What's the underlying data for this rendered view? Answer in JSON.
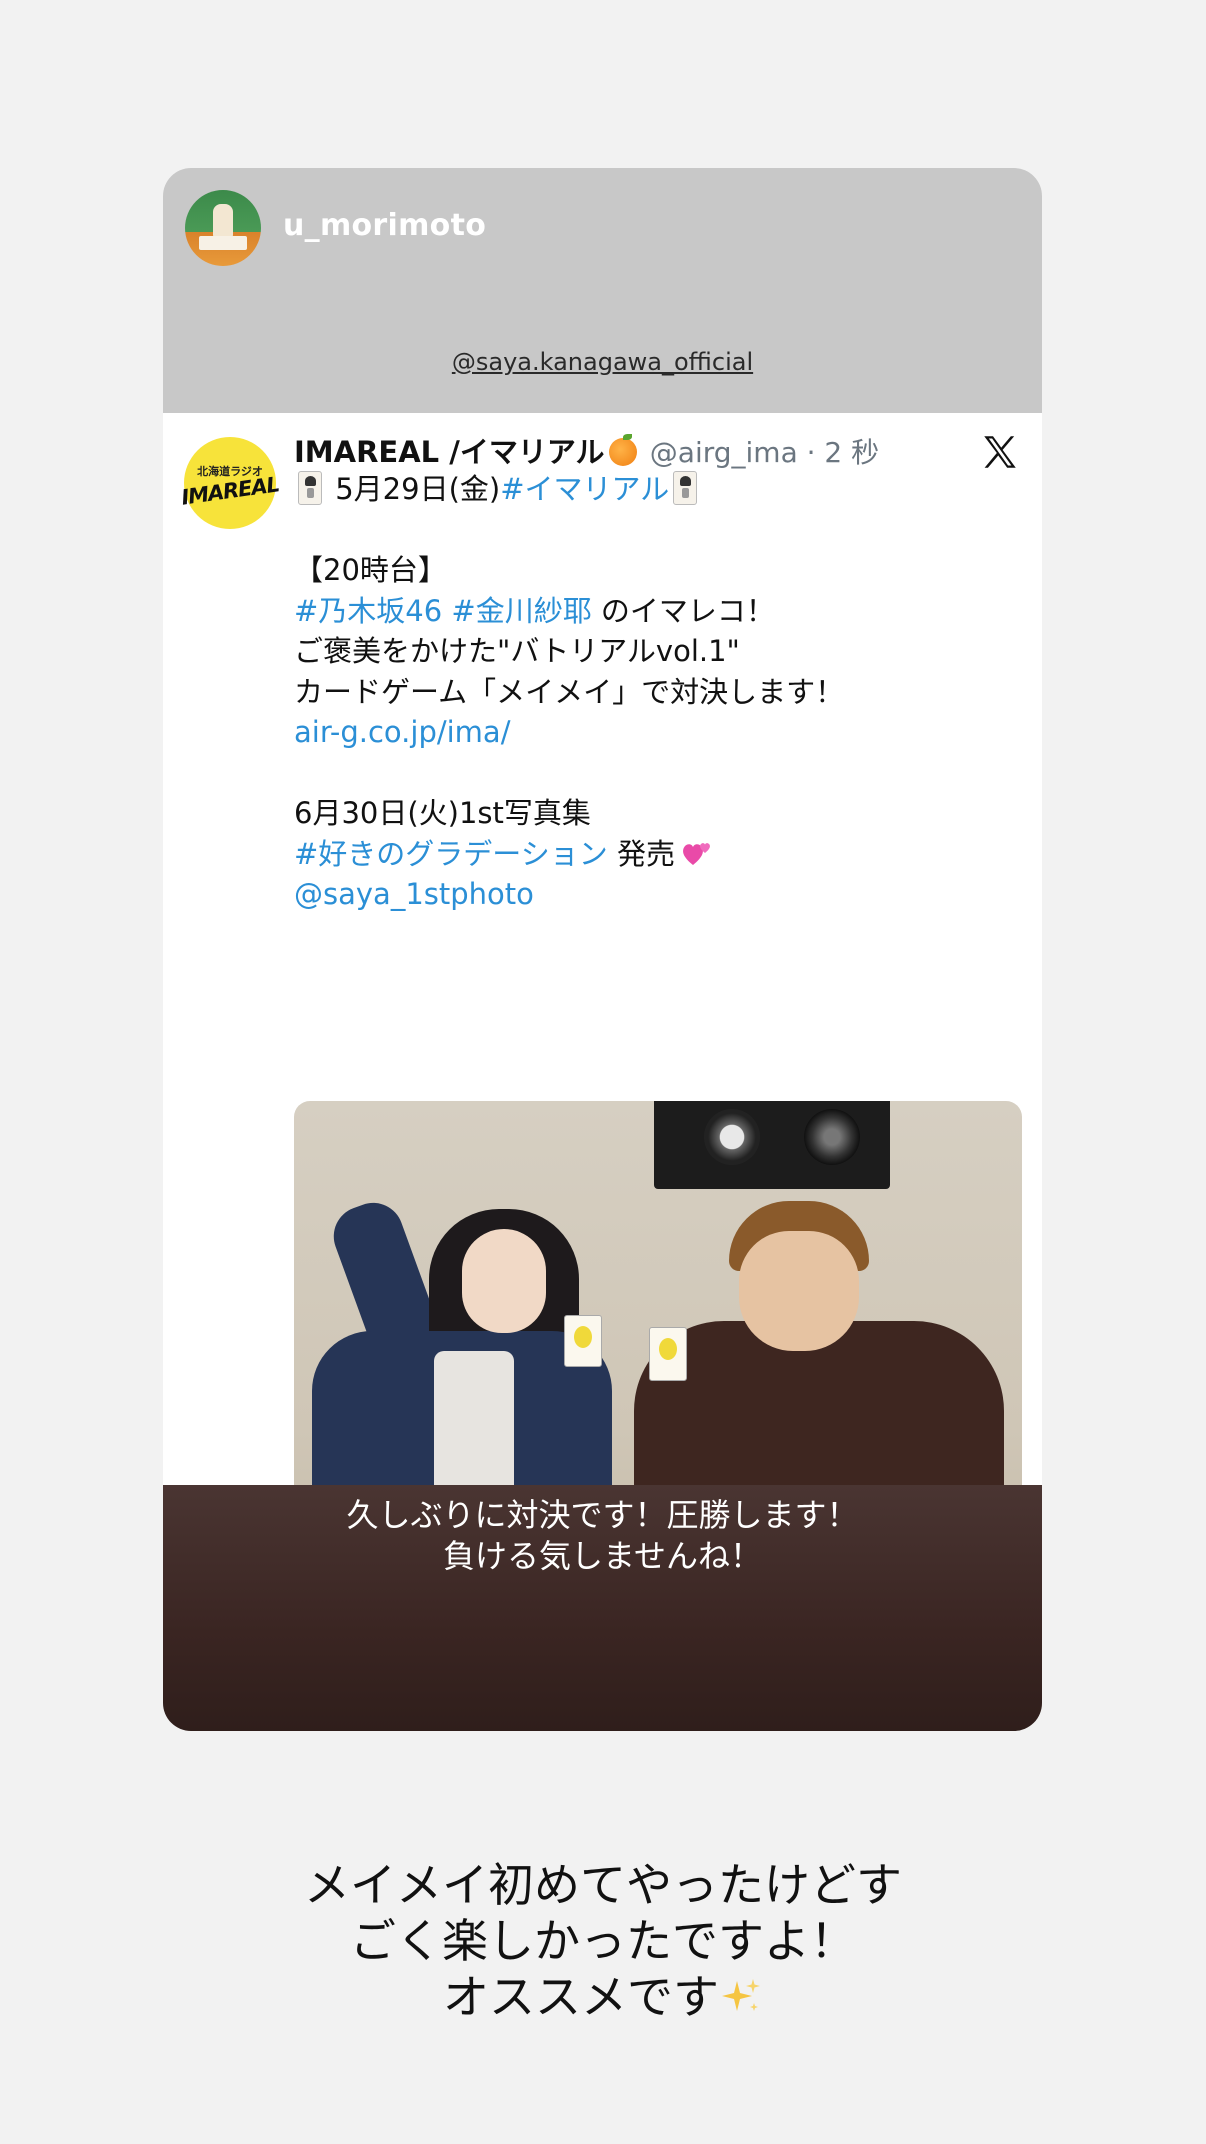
{
  "story": {
    "username": "u_morimoto",
    "mention_sticker": "@saya.kanagawa_official",
    "caption_lines": [
      "久しぶりに対決です！圧勝します！",
      "負ける気しませんね！"
    ],
    "bottom_text_lines": [
      "メイメイ初めてやったけどす",
      "ごく楽しかったですよ！",
      "オススメです"
    ]
  },
  "tweet": {
    "avatar_logo_top": "北海道ラジオ",
    "avatar_logo": "IMAREAL",
    "display_name": "IMAREAL /イマリアル",
    "handle_time": "@airg_ima · 2 秒",
    "line1_text": " 5月29日(金)",
    "line1_hashtag": "#イマリアル",
    "line2": "【20時台】",
    "line3_hashtags": "#乃木坂46 #金川紗耶",
    "line3_text": " のイマレコ！",
    "line4": "ご褒美をかけた\"バトリアルvol.1\"",
    "line5": "カードゲーム「メイメイ」で対決します！",
    "line6_link": "air-g.co.jp/ima/",
    "line7": "6月30日(火)1st写真集",
    "line8_hashtag": "#好きのグラデーション",
    "line8_text": " 発売",
    "line9_mention": "@saya_1stphoto"
  },
  "icons": {
    "x_logo": "x-logo-icon",
    "orange": "orange-emoji-icon",
    "joker": "joker-card-icon",
    "heart": "revolving-hearts-icon",
    "sparkles": "sparkles-icon"
  },
  "colors": {
    "background": "#f2f2f2",
    "link": "#2b8fd6",
    "header_gray": "#c8c8c8",
    "caption_brown": "#3a2522"
  }
}
